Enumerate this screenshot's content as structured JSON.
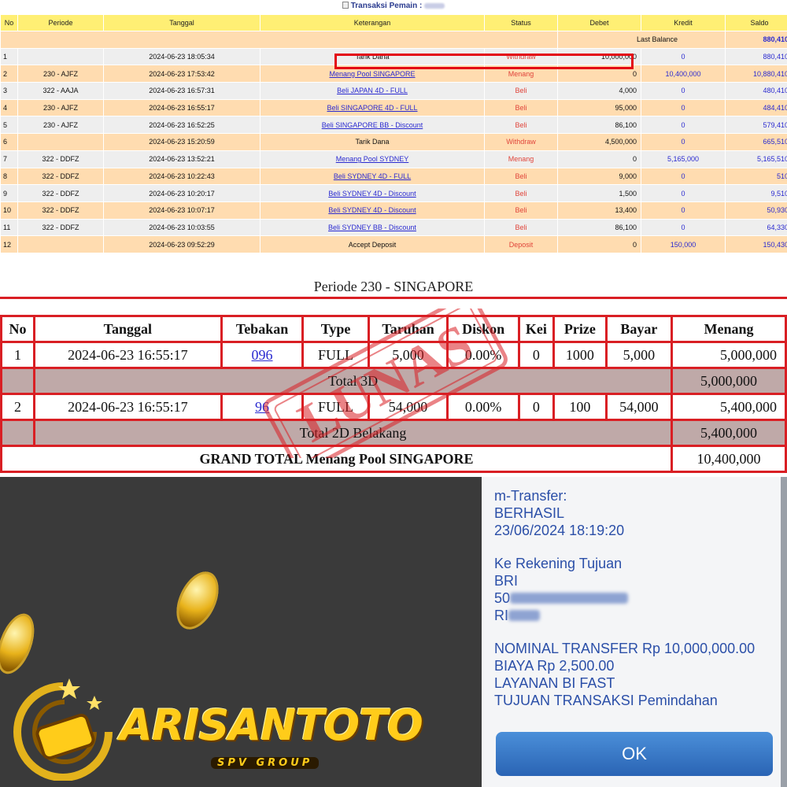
{
  "top": {
    "caption_prefix": "Transaksi  Pemain :",
    "headers": [
      "No",
      "Periode",
      "Tanggal",
      "Keterangan",
      "Status",
      "Debet",
      "Kredit",
      "Saldo"
    ],
    "last_balance_label": "Last Balance",
    "last_balance_value": "880,410",
    "rows": [
      {
        "no": "1",
        "periode": "",
        "tanggal": "2024-06-23 18:05:34",
        "keterangan": "Tarik Dana",
        "link": false,
        "status": "Withdraw",
        "debet": "10,000,000",
        "kredit": "0",
        "saldo": "880,410"
      },
      {
        "no": "2",
        "periode": "230 - AJFZ",
        "tanggal": "2024-06-23 17:53:42",
        "keterangan": "Menang Pool SINGAPORE",
        "link": true,
        "status": "Menang",
        "debet": "0",
        "kredit": "10,400,000",
        "saldo": "10,880,410"
      },
      {
        "no": "3",
        "periode": "322 - AAJA",
        "tanggal": "2024-06-23 16:57:31",
        "keterangan": "Beli JAPAN 4D - FULL",
        "link": true,
        "status": "Beli",
        "debet": "4,000",
        "kredit": "0",
        "saldo": "480,410"
      },
      {
        "no": "4",
        "periode": "230 - AJFZ",
        "tanggal": "2024-06-23 16:55:17",
        "keterangan": "Beli SINGAPORE 4D - FULL",
        "link": true,
        "status": "Beli",
        "debet": "95,000",
        "kredit": "0",
        "saldo": "484,410"
      },
      {
        "no": "5",
        "periode": "230 - AJFZ",
        "tanggal": "2024-06-23 16:52:25",
        "keterangan": "Beli SINGAPORE BB - Discount",
        "link": true,
        "status": "Beli",
        "debet": "86,100",
        "kredit": "0",
        "saldo": "579,410"
      },
      {
        "no": "6",
        "periode": "",
        "tanggal": "2024-06-23 15:20:59",
        "keterangan": "Tarik Dana",
        "link": false,
        "status": "Withdraw",
        "debet": "4,500,000",
        "kredit": "0",
        "saldo": "665,510"
      },
      {
        "no": "7",
        "periode": "322 - DDFZ",
        "tanggal": "2024-06-23 13:52:21",
        "keterangan": "Menang Pool SYDNEY",
        "link": true,
        "status": "Menang",
        "debet": "0",
        "kredit": "5,165,000",
        "saldo": "5,165,510"
      },
      {
        "no": "8",
        "periode": "322 - DDFZ",
        "tanggal": "2024-06-23 10:22:43",
        "keterangan": "Beli SYDNEY 4D - FULL",
        "link": true,
        "status": "Beli",
        "debet": "9,000",
        "kredit": "0",
        "saldo": "510"
      },
      {
        "no": "9",
        "periode": "322 - DDFZ",
        "tanggal": "2024-06-23 10:20:17",
        "keterangan": "Beli SYDNEY 4D - Discount",
        "link": true,
        "status": "Beli",
        "debet": "1,500",
        "kredit": "0",
        "saldo": "9,510"
      },
      {
        "no": "10",
        "periode": "322 - DDFZ",
        "tanggal": "2024-06-23 10:07:17",
        "keterangan": "Beli SYDNEY 4D - Discount",
        "link": true,
        "status": "Beli",
        "debet": "13,400",
        "kredit": "0",
        "saldo": "50,930"
      },
      {
        "no": "11",
        "periode": "322 - DDFZ",
        "tanggal": "2024-06-23 10:03:55",
        "keterangan": "Beli SYDNEY BB - Discount",
        "link": true,
        "status": "Beli",
        "debet": "86,100",
        "kredit": "0",
        "saldo": "64,330"
      },
      {
        "no": "12",
        "periode": "",
        "tanggal": "2024-06-23 09:52:29",
        "keterangan": "Accept Deposit",
        "link": false,
        "status": "Deposit",
        "debet": "0",
        "kredit": "150,000",
        "saldo": "150,430"
      }
    ]
  },
  "periode": {
    "title": "Periode 230 - SINGAPORE",
    "headers": [
      "No",
      "Tanggal",
      "Tebakan",
      "Type",
      "Taruhan",
      "Diskon",
      "Kei",
      "Prize",
      "Bayar",
      "Menang"
    ],
    "rows": [
      {
        "no": "1",
        "tanggal": "2024-06-23 16:55:17",
        "tebakan": "096",
        "type": "FULL",
        "taruhan": "5,000",
        "diskon": "0.00%",
        "kei": "0",
        "prize": "1000",
        "bayar": "5,000",
        "menang": "5,000,000"
      },
      {
        "no": "2",
        "tanggal": "2024-06-23 16:55:17",
        "tebakan": "96",
        "type": "FULL",
        "taruhan": "54,000",
        "diskon": "0.00%",
        "kei": "0",
        "prize": "100",
        "bayar": "54,000",
        "menang": "5,400,000"
      }
    ],
    "total_3d_label": "Total 3D",
    "total_3d_value": "5,000,000",
    "total_2d_label": "Total 2D Belakang",
    "total_2d_value": "5,400,000",
    "grand_total_label": "GRAND TOTAL  Menang Pool SINGAPORE",
    "grand_total_value": "10,400,000",
    "stamp_text": "LUNAS",
    "stamp_color": "#d91f24"
  },
  "promo": {
    "brand": "ARISANTOTO",
    "sub": "SPV GROUP",
    "brand_color": "#ffcc1a"
  },
  "receipt": {
    "l1": "m-Transfer:",
    "l2": "BERHASIL",
    "l3": "23/06/2024 18:19:20",
    "l4": "Ke Rekening Tujuan",
    "l5": "BRI",
    "l6": "50",
    "l7": "RI",
    "l8": "NOMINAL TRANSFER Rp 10,000,000.00",
    "l9": "BIAYA Rp 2,500.00",
    "l10": "LAYANAN BI FAST",
    "l11": "TUJUAN TRANSAKSI Pemindahan",
    "ok": "OK",
    "text_color": "#2b4fa8"
  }
}
